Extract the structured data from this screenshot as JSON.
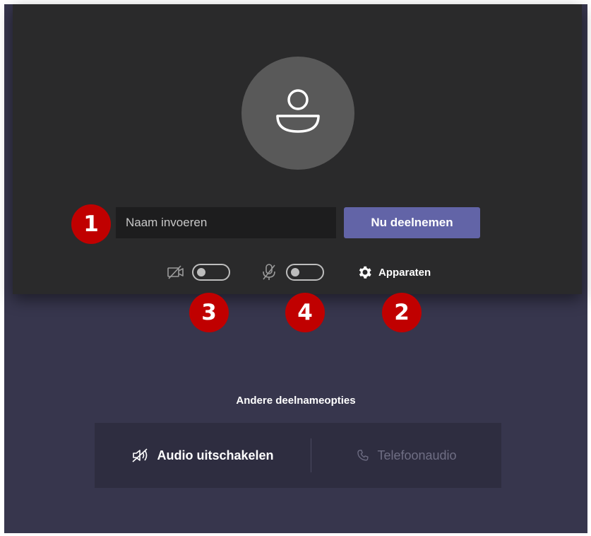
{
  "join": {
    "name_placeholder": "Naam invoeren",
    "name_value": "",
    "join_button_label": "Nu deelnemen"
  },
  "controls": {
    "camera_on": false,
    "mic_on": false,
    "devices_label": "Apparaten"
  },
  "markers": [
    "1",
    "2",
    "3",
    "4"
  ],
  "other_options": {
    "title": "Andere deelnameopties",
    "audio_off_label": "Audio uitschakelen",
    "phone_audio_label": "Telefoonaudio"
  },
  "colors": {
    "accent": "#6264a7",
    "marker": "#c00000",
    "background": "#37364d",
    "preview": "#2a2a2b"
  }
}
